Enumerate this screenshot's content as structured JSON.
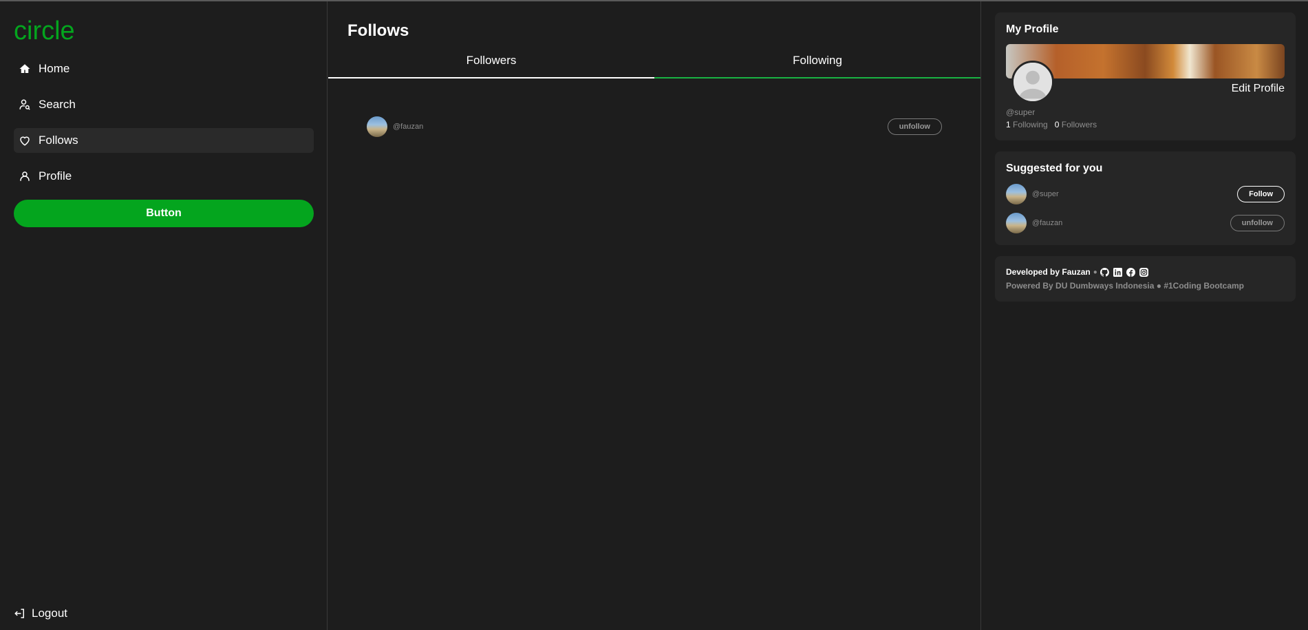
{
  "app": {
    "logo": "circle"
  },
  "sidebar": {
    "items": [
      {
        "label": "Home",
        "icon": "home-icon"
      },
      {
        "label": "Search",
        "icon": "user-search-icon"
      },
      {
        "label": "Follows",
        "icon": "heart-icon",
        "active": true
      },
      {
        "label": "Profile",
        "icon": "user-icon"
      }
    ],
    "button_label": "Button",
    "logout_label": "Logout"
  },
  "main": {
    "title": "Follows",
    "tabs": [
      {
        "label": "Followers"
      },
      {
        "label": "Following",
        "active": true
      }
    ],
    "list": [
      {
        "handle": "@fauzan",
        "action": "unfollow"
      }
    ]
  },
  "profile_card": {
    "title": "My Profile",
    "edit_label": "Edit Profile",
    "handle": "@super",
    "following_count": "1",
    "following_label": "Following",
    "followers_count": "0",
    "followers_label": "Followers"
  },
  "suggested": {
    "title": "Suggested for you",
    "items": [
      {
        "handle": "@super",
        "action": "Follow"
      },
      {
        "handle": "@fauzan",
        "action": "unfollow"
      }
    ]
  },
  "footer": {
    "developed_by": "Developed by Fauzan",
    "social_icons": [
      "github-icon",
      "linkedin-icon",
      "facebook-icon",
      "instagram-icon"
    ],
    "powered_by": "Powered By DU Dumbways Indonesia",
    "bootcamp": "#1Coding Bootcamp"
  },
  "colors": {
    "accent": "#04a51e",
    "background": "#1d1d1d",
    "card": "#262626",
    "tab_active": "#19b343"
  }
}
